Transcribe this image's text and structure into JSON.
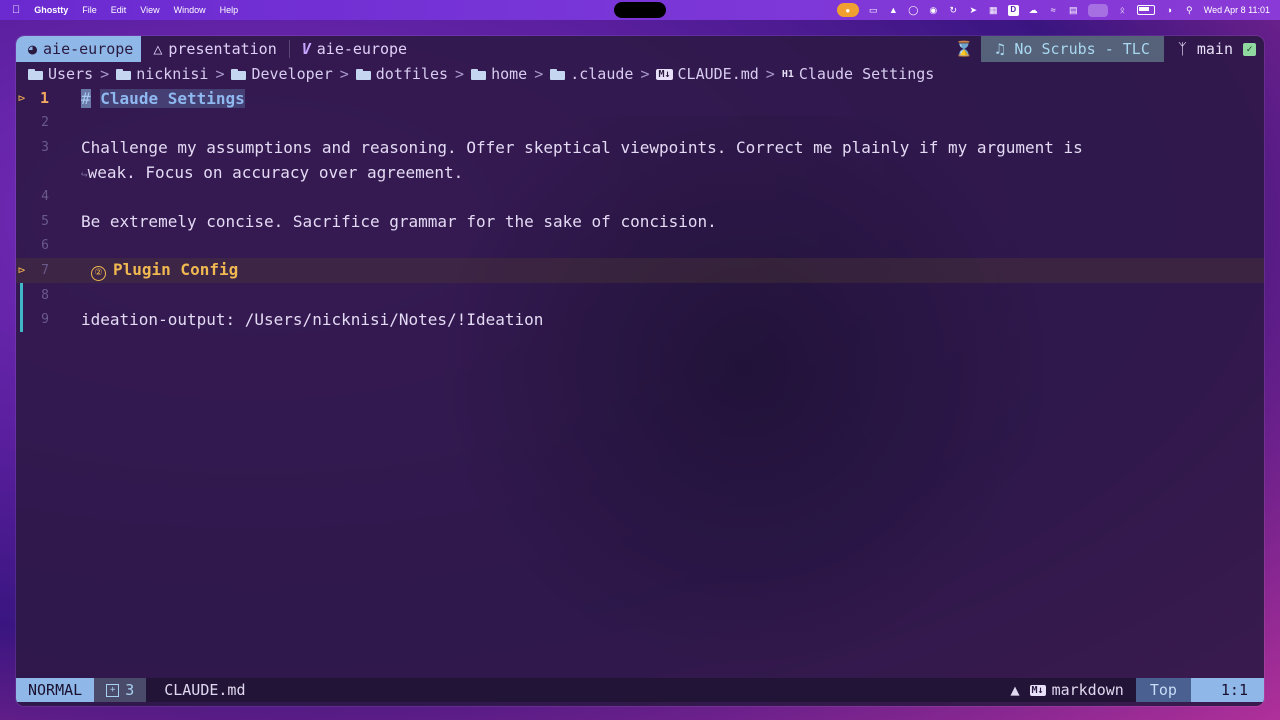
{
  "menubar": {
    "app_name": "Ghostty",
    "menus": [
      "File",
      "Edit",
      "View",
      "Window",
      "Help"
    ],
    "d_icon_letter": "D",
    "datetime": "Wed Apr 8  11:01"
  },
  "tabs": {
    "active_label": "aie-europe",
    "tab2_label": "presentation",
    "tab3_label": "aie-europe",
    "tab3_glyph": "V"
  },
  "tabline_right": {
    "music": "No Scrubs - TLC",
    "branch": "main"
  },
  "breadcrumb": {
    "items": [
      "Users",
      "nicknisi",
      "Developer",
      "dotfiles",
      "home",
      ".claude"
    ],
    "file": "CLAUDE.md",
    "file_badge": "M↓",
    "heading_badge": "H1",
    "heading": "Claude Settings"
  },
  "editor": {
    "lines": [
      {
        "num": "1",
        "h1_mark": "#",
        "h1_text": "Claude Settings"
      },
      {
        "num": "2",
        "text": ""
      },
      {
        "num": "3",
        "text": "Challenge my assumptions and reasoning. Offer skeptical viewpoints. Correct me plainly if my argument is"
      },
      {
        "num": "",
        "wrap_text": "weak. Focus on accuracy over agreement."
      },
      {
        "num": "4",
        "text": ""
      },
      {
        "num": "5",
        "text": "Be extremely concise. Sacrifice grammar for the sake of concision."
      },
      {
        "num": "6",
        "text": ""
      },
      {
        "num": "7",
        "h2_num": "②",
        "h2_text": "Plugin Config"
      },
      {
        "num": "8",
        "text": ""
      },
      {
        "num": "9",
        "text": "ideation-output: /Users/nicknisi/Notes/!Ideation"
      }
    ]
  },
  "statusline": {
    "mode": "NORMAL",
    "buffer_count": "3",
    "file": "CLAUDE.md",
    "filetype_badge": "M↓",
    "filetype": "markdown",
    "position": "Top",
    "cursor": "1:1"
  },
  "colors": {
    "accent_blue": "#8fb8e8",
    "heading2": "#f0b850",
    "git_added": "#3fb8c8"
  }
}
